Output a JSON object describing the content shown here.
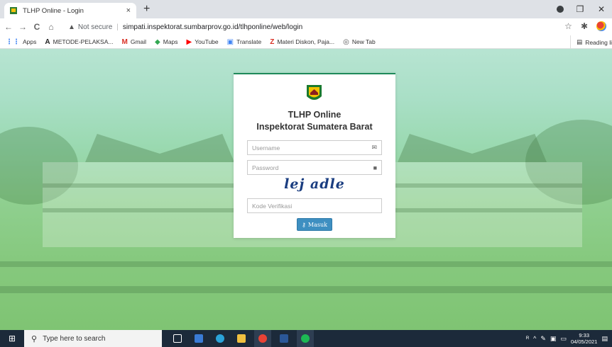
{
  "browser": {
    "tab_title": "TLHP Online - Login",
    "tab_close": "×",
    "new_tab": "+",
    "window_controls": {
      "minimize": "−",
      "maximize": "❐",
      "close": "✕"
    },
    "nav": {
      "back": "←",
      "forward": "→",
      "reload": "C",
      "home": "⌂"
    },
    "security_label": "Not secure",
    "url": "simpati.inspektorat.sumbarprov.go.id/tlhponline/web/login"
  },
  "bookmarks": {
    "items": [
      {
        "icon": "apps-grid-icon",
        "label": "Apps",
        "color": "#4285f4"
      },
      {
        "icon": "metode-a-icon",
        "label": "METODE-PELAKSA...",
        "color": "#222222"
      },
      {
        "icon": "gmail-icon",
        "label": "Gmail",
        "color": "#d93025"
      },
      {
        "icon": "maps-icon",
        "label": "Maps",
        "color": "#34a853"
      },
      {
        "icon": "youtube-icon",
        "label": "YouTube",
        "color": "#ff0000"
      },
      {
        "icon": "translate-icon",
        "label": "Translate",
        "color": "#4285f4"
      },
      {
        "icon": "zotero-z-icon",
        "label": "Materi Diskon, Paja...",
        "color": "#d93025"
      },
      {
        "icon": "globe-icon",
        "label": "New Tab",
        "color": "#555555"
      }
    ],
    "reading_list": "Reading li"
  },
  "login": {
    "title_line1": "TLHP Online",
    "title_line2": "Inspektorat Sumatera Barat",
    "username_placeholder": "Username",
    "password_placeholder": "Password",
    "captcha_text": "lej adle",
    "code_placeholder": "Kode Verifikasi",
    "submit_label": "Masuk",
    "accent_color": "#1f8a5a",
    "button_color": "#3e8fc1"
  },
  "taskbar": {
    "search_placeholder": "Type here to search",
    "time": "9:33",
    "date": "04/05/2021"
  }
}
